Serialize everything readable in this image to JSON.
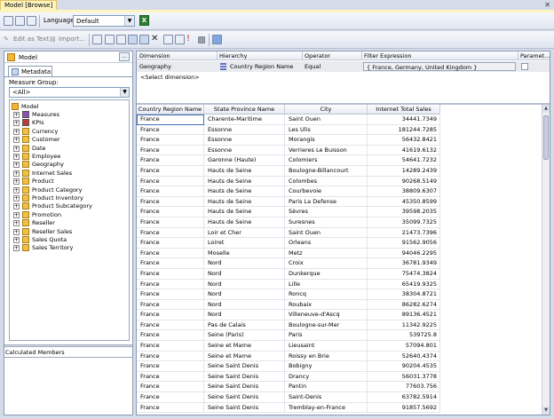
{
  "window": {
    "doc_tab_title": "Model [Browse]"
  },
  "toolbar": {
    "language_label": "Language:",
    "language_value": "Default",
    "edit_as_text": "Edit as Text",
    "import_label": "Import..."
  },
  "metadata_pane": {
    "cube_name": "Model",
    "browse_button": "...",
    "tab_label": "Metadata",
    "measure_group_label": "Measure Group:",
    "measure_group_value": "<All>",
    "tree_root": "Model",
    "tree_items": [
      "Measures",
      "KPIs",
      "Currency",
      "Customer",
      "Date",
      "Employee",
      "Geography",
      "Internet Sales",
      "Product",
      "Product Category",
      "Product Inventory",
      "Product Subcategory",
      "Promotion",
      "Reseller",
      "Reseller Sales",
      "Sales Quota",
      "Sales Territory"
    ],
    "calculated_members_label": "Calculated Members"
  },
  "filter_pane": {
    "headers": [
      "Dimension",
      "Hierarchy",
      "Operator",
      "Filter Expression",
      "Paramet..."
    ],
    "row": {
      "dimension": "Geography",
      "hierarchy": "Country Region Name",
      "operator": "Equal",
      "expression": "{ France, Germany, United Kingdom }"
    },
    "select_dimension": "<Select dimension>"
  },
  "results_grid": {
    "columns": [
      "Country Region Name",
      "State Province Name",
      "City",
      "Internet Total Sales"
    ],
    "rows": [
      [
        "France",
        "Charente-Maritime",
        "Saint Ouen",
        "34441.7349"
      ],
      [
        "France",
        "Essonne",
        "Les Ulis",
        "181244.7285"
      ],
      [
        "France",
        "Essonne",
        "Morangis",
        "56432.8421"
      ],
      [
        "France",
        "Essonne",
        "Verrieres Le Buisson",
        "41619.6132"
      ],
      [
        "France",
        "Garonne (Haute)",
        "Colomiers",
        "54641.7232"
      ],
      [
        "France",
        "Hauts de Seine",
        "Boulogne-Billancourt",
        "14289.2439"
      ],
      [
        "France",
        "Hauts de Seine",
        "Colombes",
        "90268.5149"
      ],
      [
        "France",
        "Hauts de Seine",
        "Courbevoie",
        "38809.6307"
      ],
      [
        "France",
        "Hauts de Seine",
        "Paris La Defense",
        "45350.8599"
      ],
      [
        "France",
        "Hauts de Seine",
        "Sèvres",
        "39598.2035"
      ],
      [
        "France",
        "Hauts de Seine",
        "Suresnes",
        "35099.7325"
      ],
      [
        "France",
        "Loir et Cher",
        "Saint Ouen",
        "21473.7396"
      ],
      [
        "France",
        "Loiret",
        "Orleans",
        "91562.9056"
      ],
      [
        "France",
        "Moselle",
        "Metz",
        "94046.2295"
      ],
      [
        "France",
        "Nord",
        "Croix",
        "36781.9349"
      ],
      [
        "France",
        "Nord",
        "Dunkerque",
        "75474.3824"
      ],
      [
        "France",
        "Nord",
        "Lille",
        "65419.9325"
      ],
      [
        "France",
        "Nord",
        "Roncq",
        "38304.8721"
      ],
      [
        "France",
        "Nord",
        "Roubaix",
        "86282.6274"
      ],
      [
        "France",
        "Nord",
        "Villeneuve-d'Ascq",
        "89136.4521"
      ],
      [
        "France",
        "Pas de Calais",
        "Boulogne-sur-Mer",
        "11342.9225"
      ],
      [
        "France",
        "Seine (Paris)",
        "Paris",
        "539725.8"
      ],
      [
        "France",
        "Seine et Marne",
        "Lieusaint",
        "57094.801"
      ],
      [
        "France",
        "Seine et Marne",
        "Roissy en Brie",
        "52640.4374"
      ],
      [
        "France",
        "Seine Saint Denis",
        "Bobigny",
        "90204.4535"
      ],
      [
        "France",
        "Seine Saint Denis",
        "Drancy",
        "56031.3778"
      ],
      [
        "France",
        "Seine Saint Denis",
        "Pantin",
        "77603.756"
      ],
      [
        "France",
        "Seine Saint Denis",
        "Saint-Denis",
        "63782.5914"
      ],
      [
        "France",
        "Seine Saint Denis",
        "Tremblay-en-France",
        "91857.5692"
      ]
    ]
  }
}
